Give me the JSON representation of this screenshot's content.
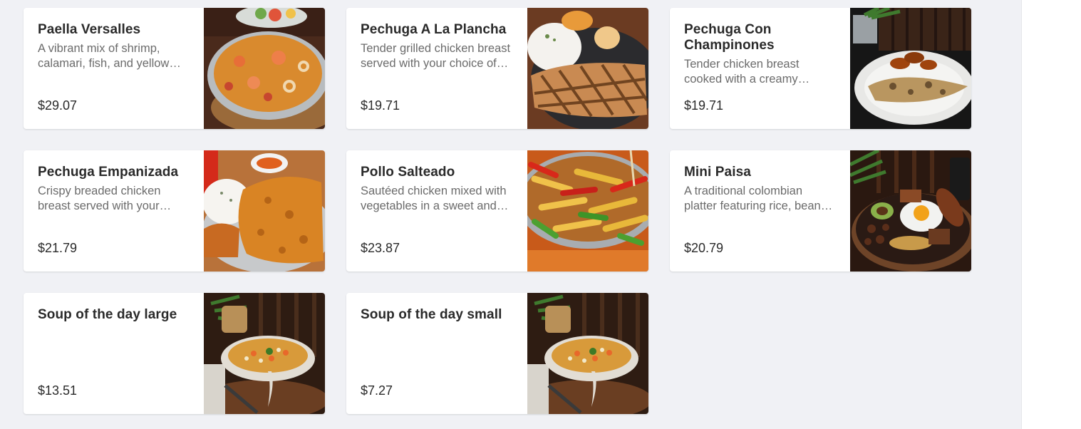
{
  "menu": {
    "items": [
      {
        "name": "Paella Versalles",
        "description": "A vibrant mix of shrimp, calamari, fish, and yellow rice cooked with peppers and seasonings",
        "price": "$29.07"
      },
      {
        "name": "Pechuga A La Plancha",
        "description": "Tender grilled chicken breast served with your choice of sides",
        "price": "$19.71"
      },
      {
        "name": "Pechuga Con Champinones",
        "description": "Tender chicken breast cooked with a creamy mushroom sauce",
        "price": "$19.71"
      },
      {
        "name": "Pechuga Empanizada",
        "description": "Crispy breaded chicken breast served with your choice of sides",
        "price": "$21.79"
      },
      {
        "name": "Pollo Salteado",
        "description": "Sautéed chicken mixed with vegetables in a sweet and savory sauce",
        "price": "$23.87"
      },
      {
        "name": "Mini Paisa",
        "description": "A traditional colombian platter featuring rice, beans, egg, plantain and meats",
        "price": "$20.79"
      },
      {
        "name": "Soup of the day large",
        "description": "",
        "price": "$13.51"
      },
      {
        "name": "Soup of the day small",
        "description": "",
        "price": "$7.27"
      }
    ]
  }
}
